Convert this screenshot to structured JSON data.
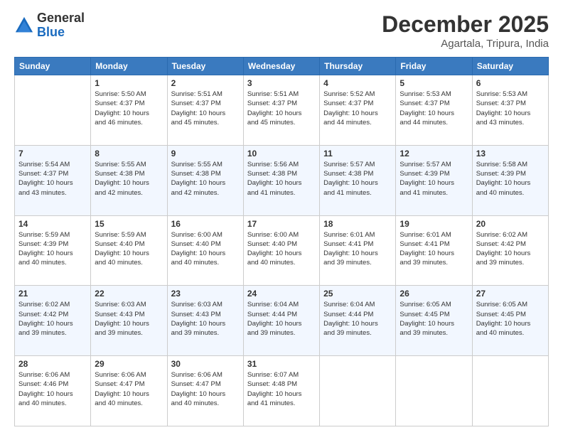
{
  "logo": {
    "general": "General",
    "blue": "Blue"
  },
  "title": "December 2025",
  "subtitle": "Agartala, Tripura, India",
  "days": [
    "Sunday",
    "Monday",
    "Tuesday",
    "Wednesday",
    "Thursday",
    "Friday",
    "Saturday"
  ],
  "weeks": [
    [
      {
        "day": "",
        "info": ""
      },
      {
        "day": "1",
        "info": "Sunrise: 5:50 AM\nSunset: 4:37 PM\nDaylight: 10 hours\nand 46 minutes."
      },
      {
        "day": "2",
        "info": "Sunrise: 5:51 AM\nSunset: 4:37 PM\nDaylight: 10 hours\nand 45 minutes."
      },
      {
        "day": "3",
        "info": "Sunrise: 5:51 AM\nSunset: 4:37 PM\nDaylight: 10 hours\nand 45 minutes."
      },
      {
        "day": "4",
        "info": "Sunrise: 5:52 AM\nSunset: 4:37 PM\nDaylight: 10 hours\nand 44 minutes."
      },
      {
        "day": "5",
        "info": "Sunrise: 5:53 AM\nSunset: 4:37 PM\nDaylight: 10 hours\nand 44 minutes."
      },
      {
        "day": "6",
        "info": "Sunrise: 5:53 AM\nSunset: 4:37 PM\nDaylight: 10 hours\nand 43 minutes."
      }
    ],
    [
      {
        "day": "7",
        "info": "Sunrise: 5:54 AM\nSunset: 4:37 PM\nDaylight: 10 hours\nand 43 minutes."
      },
      {
        "day": "8",
        "info": "Sunrise: 5:55 AM\nSunset: 4:38 PM\nDaylight: 10 hours\nand 42 minutes."
      },
      {
        "day": "9",
        "info": "Sunrise: 5:55 AM\nSunset: 4:38 PM\nDaylight: 10 hours\nand 42 minutes."
      },
      {
        "day": "10",
        "info": "Sunrise: 5:56 AM\nSunset: 4:38 PM\nDaylight: 10 hours\nand 41 minutes."
      },
      {
        "day": "11",
        "info": "Sunrise: 5:57 AM\nSunset: 4:38 PM\nDaylight: 10 hours\nand 41 minutes."
      },
      {
        "day": "12",
        "info": "Sunrise: 5:57 AM\nSunset: 4:39 PM\nDaylight: 10 hours\nand 41 minutes."
      },
      {
        "day": "13",
        "info": "Sunrise: 5:58 AM\nSunset: 4:39 PM\nDaylight: 10 hours\nand 40 minutes."
      }
    ],
    [
      {
        "day": "14",
        "info": "Sunrise: 5:59 AM\nSunset: 4:39 PM\nDaylight: 10 hours\nand 40 minutes."
      },
      {
        "day": "15",
        "info": "Sunrise: 5:59 AM\nSunset: 4:40 PM\nDaylight: 10 hours\nand 40 minutes."
      },
      {
        "day": "16",
        "info": "Sunrise: 6:00 AM\nSunset: 4:40 PM\nDaylight: 10 hours\nand 40 minutes."
      },
      {
        "day": "17",
        "info": "Sunrise: 6:00 AM\nSunset: 4:40 PM\nDaylight: 10 hours\nand 40 minutes."
      },
      {
        "day": "18",
        "info": "Sunrise: 6:01 AM\nSunset: 4:41 PM\nDaylight: 10 hours\nand 39 minutes."
      },
      {
        "day": "19",
        "info": "Sunrise: 6:01 AM\nSunset: 4:41 PM\nDaylight: 10 hours\nand 39 minutes."
      },
      {
        "day": "20",
        "info": "Sunrise: 6:02 AM\nSunset: 4:42 PM\nDaylight: 10 hours\nand 39 minutes."
      }
    ],
    [
      {
        "day": "21",
        "info": "Sunrise: 6:02 AM\nSunset: 4:42 PM\nDaylight: 10 hours\nand 39 minutes."
      },
      {
        "day": "22",
        "info": "Sunrise: 6:03 AM\nSunset: 4:43 PM\nDaylight: 10 hours\nand 39 minutes."
      },
      {
        "day": "23",
        "info": "Sunrise: 6:03 AM\nSunset: 4:43 PM\nDaylight: 10 hours\nand 39 minutes."
      },
      {
        "day": "24",
        "info": "Sunrise: 6:04 AM\nSunset: 4:44 PM\nDaylight: 10 hours\nand 39 minutes."
      },
      {
        "day": "25",
        "info": "Sunrise: 6:04 AM\nSunset: 4:44 PM\nDaylight: 10 hours\nand 39 minutes."
      },
      {
        "day": "26",
        "info": "Sunrise: 6:05 AM\nSunset: 4:45 PM\nDaylight: 10 hours\nand 39 minutes."
      },
      {
        "day": "27",
        "info": "Sunrise: 6:05 AM\nSunset: 4:45 PM\nDaylight: 10 hours\nand 40 minutes."
      }
    ],
    [
      {
        "day": "28",
        "info": "Sunrise: 6:06 AM\nSunset: 4:46 PM\nDaylight: 10 hours\nand 40 minutes."
      },
      {
        "day": "29",
        "info": "Sunrise: 6:06 AM\nSunset: 4:47 PM\nDaylight: 10 hours\nand 40 minutes."
      },
      {
        "day": "30",
        "info": "Sunrise: 6:06 AM\nSunset: 4:47 PM\nDaylight: 10 hours\nand 40 minutes."
      },
      {
        "day": "31",
        "info": "Sunrise: 6:07 AM\nSunset: 4:48 PM\nDaylight: 10 hours\nand 41 minutes."
      },
      {
        "day": "",
        "info": ""
      },
      {
        "day": "",
        "info": ""
      },
      {
        "day": "",
        "info": ""
      }
    ]
  ]
}
